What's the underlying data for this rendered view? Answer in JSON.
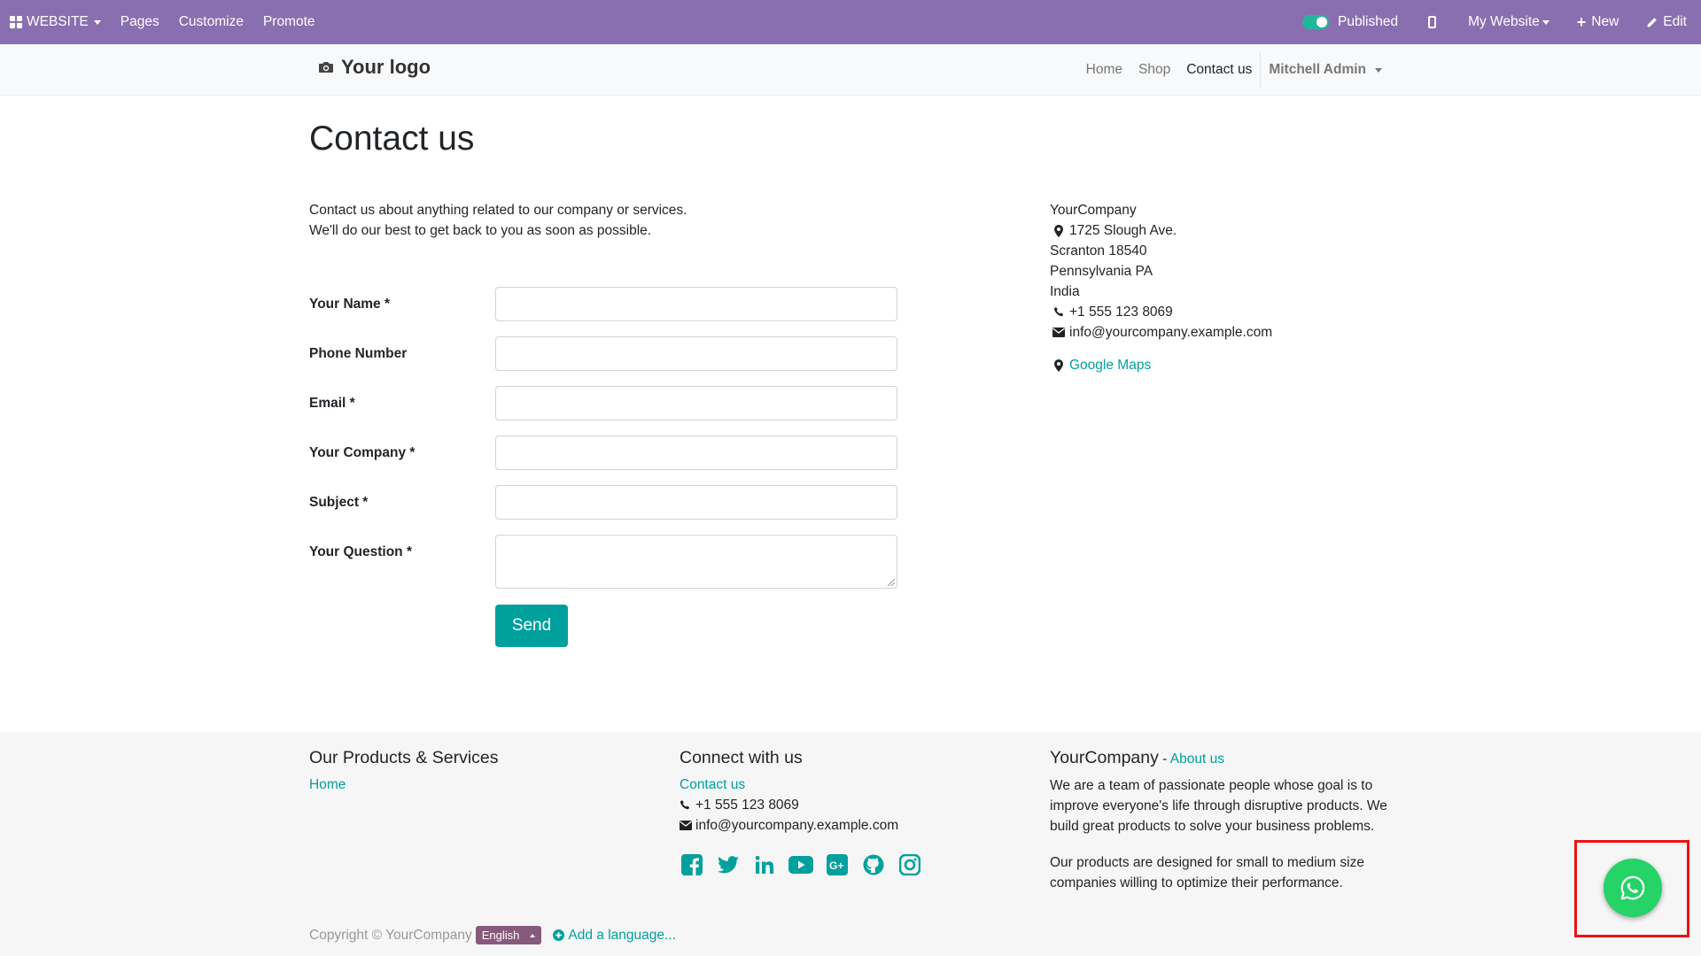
{
  "admin_bar": {
    "website_menu": "WEBSITE",
    "pages": "Pages",
    "customize": "Customize",
    "promote": "Promote",
    "published": "Published",
    "my_website": "My Website",
    "new": "New",
    "edit": "Edit"
  },
  "header": {
    "logo": "Your logo",
    "nav": [
      "Home",
      "Shop",
      "Contact us"
    ],
    "user": "Mitchell Admin"
  },
  "page": {
    "title": "Contact us",
    "intro_line1": "Contact us about anything related to our company or services.",
    "intro_line2": "We'll do our best to get back to you as soon as possible."
  },
  "form": {
    "fields": [
      {
        "label": "Your Name *",
        "value": ""
      },
      {
        "label": "Phone Number",
        "value": ""
      },
      {
        "label": "Email *",
        "value": ""
      },
      {
        "label": "Your Company *",
        "value": ""
      },
      {
        "label": "Subject *",
        "value": ""
      },
      {
        "label": "Your Question *",
        "value": ""
      }
    ],
    "submit": "Send"
  },
  "company_info": {
    "name": "YourCompany",
    "street": "1725 Slough Ave.",
    "city": "Scranton 18540",
    "state": "Pennsylvania PA",
    "country": "India",
    "phone": "+1 555 123 8069",
    "email": "info@yourcompany.example.com",
    "maps": "Google Maps"
  },
  "footer": {
    "products_title": "Our Products & Services",
    "products_link": "Home",
    "connect_title": "Connect with us",
    "connect_link": "Contact us",
    "phone": "+1 555 123 8069",
    "email": "info@yourcompany.example.com",
    "social": [
      "facebook-icon",
      "twitter-icon",
      "linkedin-icon",
      "youtube-icon",
      "google-plus-icon",
      "github-icon",
      "instagram-icon"
    ],
    "about_company": "YourCompany",
    "about_sep": " - ",
    "about_link": "About us",
    "about_p1": "We are a team of passionate people whose goal is to improve everyone's life through disruptive products. We build great products to solve your business problems.",
    "about_p2": "Our products are designed for small to medium size companies willing to optimize their performance.",
    "copyright": "Copyright © YourCompany",
    "language": "English",
    "add_language": "Add a language..."
  },
  "colors": {
    "admin_bar": "#8a6fb0",
    "primary": "#00a09d",
    "whatsapp": "#25d366",
    "highlight": "#ee1111"
  }
}
